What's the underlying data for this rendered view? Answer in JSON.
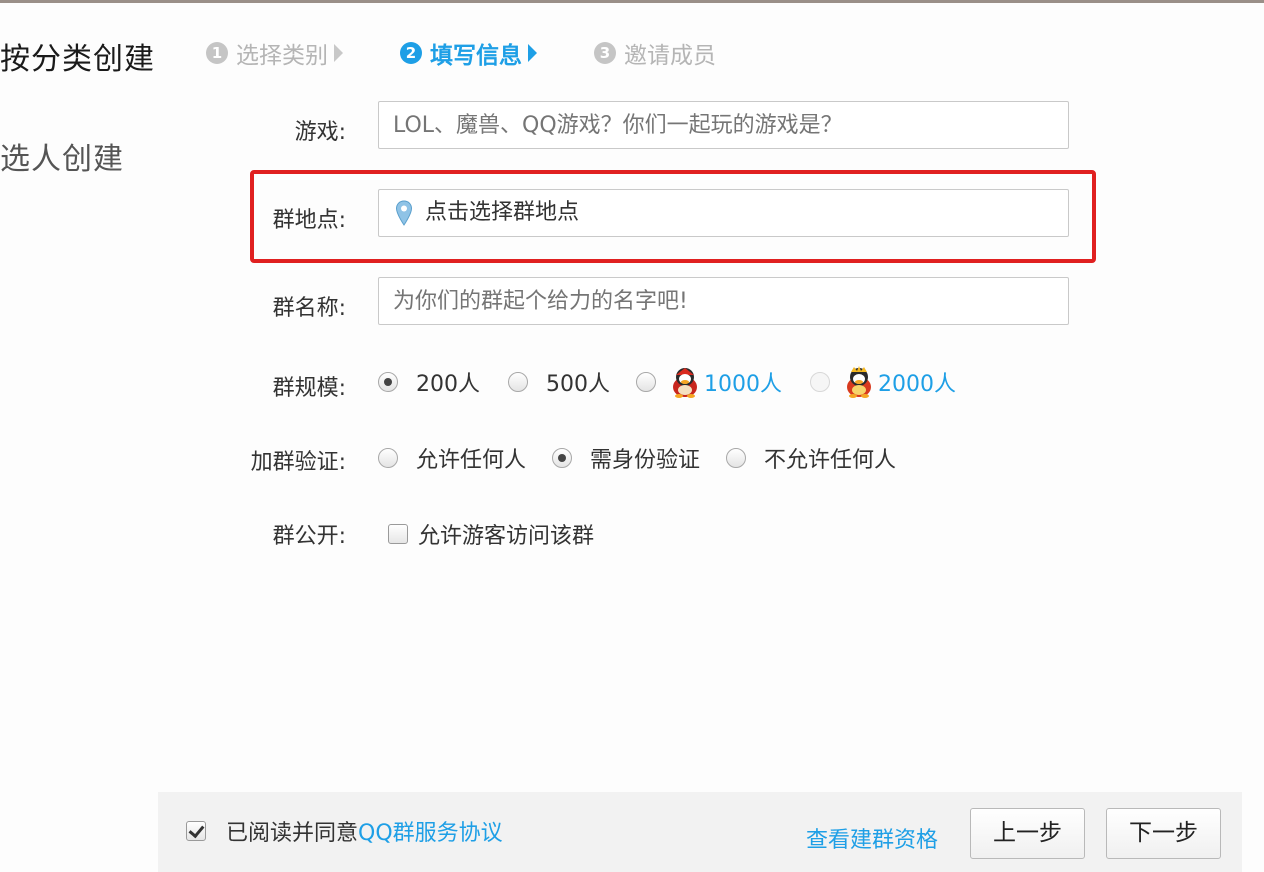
{
  "nav": {
    "by_category": "按分类创建",
    "by_people": "选人创建"
  },
  "steps": [
    {
      "num": "1",
      "label": "选择类别"
    },
    {
      "num": "2",
      "label": "填写信息"
    },
    {
      "num": "3",
      "label": "邀请成员"
    }
  ],
  "form": {
    "game": {
      "label": "游戏:",
      "placeholder": "LOL、魔兽、QQ游戏？你们一起玩的游戏是？"
    },
    "location": {
      "label": "群地点:",
      "value": "点击选择群地点"
    },
    "name": {
      "label": "群名称:",
      "placeholder": "为你们的群起个给力的名字吧!"
    },
    "size": {
      "label": "群规模:",
      "options": [
        "200人",
        "500人",
        "1000人",
        "2000人"
      ],
      "selected": "200人"
    },
    "verify": {
      "label": "加群验证:",
      "options": [
        "允许任何人",
        "需身份验证",
        "不允许任何人"
      ],
      "selected": "需身份验证"
    },
    "public": {
      "label": "群公开:",
      "checkbox_label": "允许游客访问该群",
      "checked": false
    }
  },
  "footer": {
    "agree_prefix": "已阅读并同意",
    "agree_link": "QQ群服务协议",
    "agree_checked": true,
    "view_qualification": "查看建群资格",
    "prev_button": "上一步",
    "next_button": "下一步"
  },
  "colors": {
    "accent": "#1e9fe6",
    "highlight": "#e02020"
  },
  "icons": {
    "location": "map-pin-icon",
    "vip_1000": "red-penguin-icon",
    "vip_2000": "gold-penguin-icon"
  }
}
